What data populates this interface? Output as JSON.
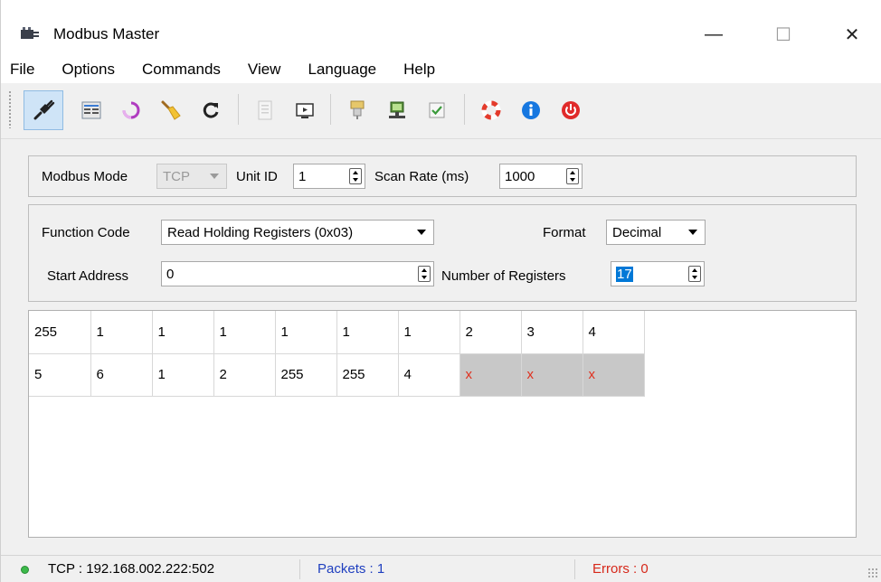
{
  "window": {
    "title": "Modbus Master",
    "controls": {
      "minimize": "—",
      "maximize": "☐",
      "close": "✕"
    }
  },
  "menu": [
    "File",
    "Options",
    "Commands",
    "View",
    "Language",
    "Help"
  ],
  "toolbar": {
    "buttons": [
      {
        "name": "connect",
        "icon": "plug-icon",
        "active": true
      },
      {
        "name": "modbus-definitions",
        "icon": "definitions-icon"
      },
      {
        "name": "scan",
        "icon": "scan-icon"
      },
      {
        "name": "clear",
        "icon": "broom-icon"
      },
      {
        "name": "read-write-once",
        "icon": "refresh-icon"
      },
      {
        "name": "write",
        "icon": "document-icon"
      },
      {
        "name": "bus-monitor",
        "icon": "monitor-icon"
      },
      {
        "name": "serial-port-settings",
        "icon": "serial-port-icon"
      },
      {
        "name": "tcp-settings",
        "icon": "network-icon"
      },
      {
        "name": "log-settings",
        "icon": "checkbox-icon"
      },
      {
        "name": "help-contents",
        "icon": "lifebuoy-icon"
      },
      {
        "name": "about",
        "icon": "info-icon"
      },
      {
        "name": "exit",
        "icon": "power-icon"
      }
    ]
  },
  "settings": {
    "modbus_mode_label": "Modbus Mode",
    "modbus_mode_value": "TCP",
    "unit_id_label": "Unit ID",
    "unit_id_value": "1",
    "scan_rate_label": "Scan Rate (ms)",
    "scan_rate_value": "1000"
  },
  "request": {
    "function_code_label": "Function Code",
    "function_code_value": "Read Holding Registers (0x03)",
    "format_label": "Format",
    "format_value": "Decimal",
    "start_address_label": "Start Address",
    "start_address_value": "0",
    "number_of_registers_label": "Number of Registers",
    "number_of_registers_value": "17"
  },
  "registers": {
    "rows": [
      [
        "255",
        "1",
        "1",
        "1",
        "1",
        "1",
        "1",
        "2",
        "3",
        "4"
      ],
      [
        "5",
        "6",
        "1",
        "2",
        "255",
        "255",
        "4",
        "x",
        "x",
        "x"
      ]
    ],
    "error_marker": "x"
  },
  "status": {
    "connection": "TCP : 192.168.002.222:502",
    "packets": "Packets : 1",
    "errors": "Errors : 0",
    "colors": {
      "connected_dot": "#3cb94a",
      "packets": "#1f3fbf",
      "errors": "#d6281a"
    }
  }
}
